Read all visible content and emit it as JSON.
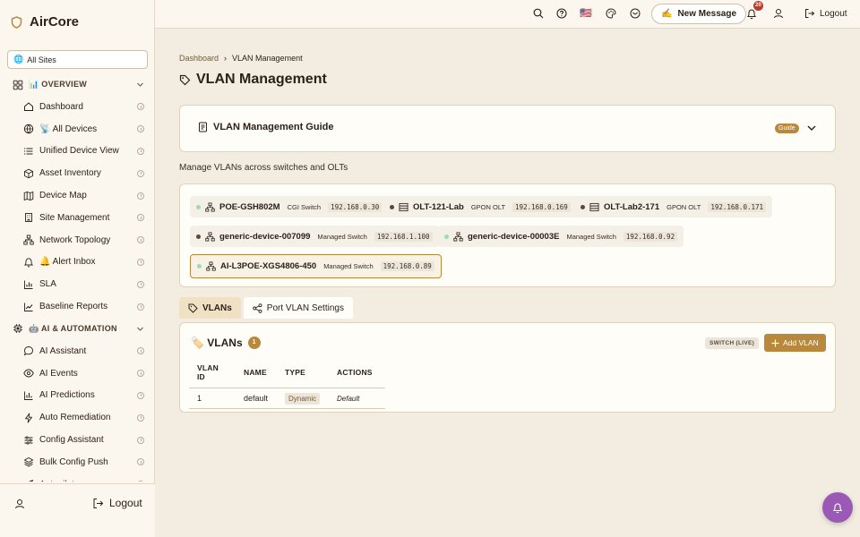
{
  "brand": {
    "name": "AirCore"
  },
  "site_selector": {
    "value": "All Sites",
    "icon": "globe-icon"
  },
  "sidebar": {
    "sections": [
      {
        "label": "📊 OVERVIEW",
        "icon": "grid-icon",
        "items": [
          {
            "label": "Dashboard",
            "icon": "home-icon"
          },
          {
            "label": "📡 All Devices",
            "icon": "globe-icon"
          },
          {
            "label": "Unified Device View",
            "icon": "list-icon"
          },
          {
            "label": "Asset Inventory",
            "icon": "box-icon"
          },
          {
            "label": "Device Map",
            "icon": "map-icon"
          },
          {
            "label": "Site Management",
            "icon": "building-icon"
          },
          {
            "label": "Network Topology",
            "icon": "network-icon"
          },
          {
            "label": "🔔 Alert Inbox",
            "icon": "bell-icon"
          },
          {
            "label": "SLA",
            "icon": "bar-chart-icon"
          },
          {
            "label": "Baseline Reports",
            "icon": "trend-icon"
          }
        ]
      },
      {
        "label": "🤖 AI & AUTOMATION",
        "icon": "cpu-icon",
        "items": [
          {
            "label": "AI Assistant",
            "icon": "chat-icon"
          },
          {
            "label": "AI Events",
            "icon": "eye-icon"
          },
          {
            "label": "AI Predictions",
            "icon": "chart-icon"
          },
          {
            "label": "Auto Remediation",
            "icon": "bolt-icon"
          },
          {
            "label": "Config Assistant",
            "icon": "sliders-icon"
          },
          {
            "label": "Bulk Config Push",
            "icon": "layers-icon"
          },
          {
            "label": "Autopilot",
            "icon": "send-icon"
          }
        ]
      }
    ],
    "footer": {
      "logout_label": "Logout"
    }
  },
  "topbar": {
    "new_message_label": "New Message",
    "new_message_emoji": "✍️",
    "flag": "🇺🇸",
    "notification_count": "20",
    "logout_label": "Logout"
  },
  "breadcrumb": {
    "home": "Dashboard",
    "separator": "›",
    "current": "VLAN Management"
  },
  "page": {
    "title": "VLAN Management",
    "subtitle": "Manage VLANs across switches and OLTs"
  },
  "guide": {
    "title": "VLAN Management Guide",
    "badge": "Guide"
  },
  "devices": [
    {
      "name": "POE-GSH802M",
      "type": "CGI Switch",
      "ip": "192.168.0.30",
      "status_color": "#9ddbb0",
      "icon": "network-icon",
      "selected": false
    },
    {
      "name": "OLT-121-Lab",
      "type": "GPON OLT",
      "ip": "192.168.0.169",
      "status_color": "#5a4a38",
      "icon": "server-icon",
      "selected": false
    },
    {
      "name": "OLT-Lab2-171",
      "type": "GPON OLT",
      "ip": "192.168.0.171",
      "status_color": "#5a4a38",
      "icon": "server-icon",
      "selected": false
    },
    {
      "name": "generic-device-007099",
      "type": "Managed Switch",
      "ip": "192.168.1.100",
      "status_color": "#5a4a38",
      "icon": "network-icon",
      "selected": false
    },
    {
      "name": "generic-device-00003E",
      "type": "Managed Switch",
      "ip": "192.168.0.92",
      "status_color": "#9ddbb0",
      "icon": "network-icon",
      "selected": false
    },
    {
      "name": "AI-L3POE-XGS4806-450",
      "type": "Managed Switch",
      "ip": "192.168.0.89",
      "status_color": "#9ddbb0",
      "icon": "network-icon",
      "selected": true
    }
  ],
  "tabs": [
    {
      "label": "VLANs",
      "active": true
    },
    {
      "label": "Port VLAN Settings",
      "active": false
    }
  ],
  "vlans": {
    "title": "🏷️ VLANs",
    "count": "1",
    "mode_badge": "SWITCH (LIVE)",
    "add_label": "Add VLAN",
    "columns": [
      "VLAN ID",
      "NAME",
      "TYPE",
      "ACTIONS"
    ],
    "rows": [
      {
        "id": "1",
        "name": "default",
        "type": "Dynamic",
        "action": "Default"
      }
    ]
  },
  "colors": {
    "accent": "#b8893c",
    "sidebar_bg": "#fbf6ee",
    "page_bg": "#f3ece1",
    "fab": "#9b59b6"
  }
}
